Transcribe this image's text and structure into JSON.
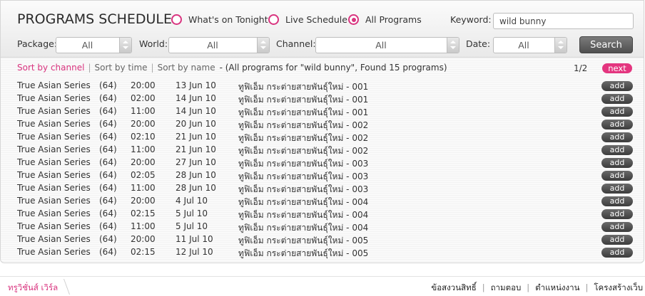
{
  "header": {
    "title": "PROGRAMS SCHEDULE",
    "radios": [
      {
        "label": "What's on Tonight",
        "selected": false
      },
      {
        "label": "Live Schedule",
        "selected": false
      },
      {
        "label": "All Programs",
        "selected": true
      }
    ],
    "keyword_label": "Keyword:",
    "keyword_value": "wild bunny",
    "filters": {
      "package_label": "Package:",
      "package_value": "All",
      "world_label": "World:",
      "world_value": "All",
      "channel_label": "Channel:",
      "channel_value": "All",
      "date_label": "Date:",
      "date_value": "All"
    },
    "search_label": "Search"
  },
  "sort": {
    "by_channel": "Sort by channel",
    "by_time": "Sort by time",
    "by_name": "Sort by name",
    "summary": "-  (All programs for \"wild bunny\", Found 15 programs)"
  },
  "pagination": {
    "page": "1/2",
    "next_label": "next"
  },
  "add_label": "add",
  "programs": [
    {
      "channel": "True Asian Series",
      "num": "(64)",
      "time": "20:00",
      "date": "13 Jun 10",
      "title": "ทูฟิเอ็ม กระต่ายสายพันธุ์ใหม่ - 001"
    },
    {
      "channel": "True Asian Series",
      "num": "(64)",
      "time": "02:00",
      "date": "14 Jun 10",
      "title": "ทูฟิเอ็ม กระต่ายสายพันธุ์ใหม่ - 001"
    },
    {
      "channel": "True Asian Series",
      "num": "(64)",
      "time": "11:00",
      "date": "14 Jun 10",
      "title": "ทูฟิเอ็ม กระต่ายสายพันธุ์ใหม่ - 001"
    },
    {
      "channel": "True Asian Series",
      "num": "(64)",
      "time": "20:00",
      "date": "20 Jun 10",
      "title": "ทูฟิเอ็ม กระต่ายสายพันธุ์ใหม่ - 002"
    },
    {
      "channel": "True Asian Series",
      "num": "(64)",
      "time": "02:10",
      "date": "21 Jun 10",
      "title": "ทูฟิเอ็ม กระต่ายสายพันธุ์ใหม่ - 002"
    },
    {
      "channel": "True Asian Series",
      "num": "(64)",
      "time": "11:00",
      "date": "21 Jun 10",
      "title": "ทูฟิเอ็ม กระต่ายสายพันธุ์ใหม่ - 002"
    },
    {
      "channel": "True Asian Series",
      "num": "(64)",
      "time": "20:00",
      "date": "27 Jun 10",
      "title": "ทูฟิเอ็ม กระต่ายสายพันธุ์ใหม่ - 003"
    },
    {
      "channel": "True Asian Series",
      "num": "(64)",
      "time": "02:05",
      "date": "28 Jun 10",
      "title": "ทูฟิเอ็ม กระต่ายสายพันธุ์ใหม่ - 003"
    },
    {
      "channel": "True Asian Series",
      "num": "(64)",
      "time": "11:00",
      "date": "28 Jun 10",
      "title": "ทูฟิเอ็ม กระต่ายสายพันธุ์ใหม่ - 003"
    },
    {
      "channel": "True Asian Series",
      "num": "(64)",
      "time": "20:00",
      "date": "4 Jul 10",
      "title": "ทูฟิเอ็ม กระต่ายสายพันธุ์ใหม่ - 004"
    },
    {
      "channel": "True Asian Series",
      "num": "(64)",
      "time": "02:15",
      "date": "5 Jul 10",
      "title": "ทูฟิเอ็ม กระต่ายสายพันธุ์ใหม่ - 004"
    },
    {
      "channel": "True Asian Series",
      "num": "(64)",
      "time": "11:00",
      "date": "5 Jul 10",
      "title": "ทูฟิเอ็ม กระต่ายสายพันธุ์ใหม่ - 004"
    },
    {
      "channel": "True Asian Series",
      "num": "(64)",
      "time": "20:00",
      "date": "11 Jul 10",
      "title": "ทูฟิเอ็ม กระต่ายสายพันธุ์ใหม่ - 005"
    },
    {
      "channel": "True Asian Series",
      "num": "(64)",
      "time": "02:15",
      "date": "12 Jul 10",
      "title": "ทูฟิเอ็ม กระต่ายสายพันธุ์ใหม่ - 005"
    }
  ],
  "footer": {
    "brand": "ทรูวิชั่นส์ เวิร์ล",
    "links": [
      "ข้อสงวนสิทธิ์",
      "ถามตอบ",
      "ตำแหน่งงาน",
      "โครงสร้างเว็บ"
    ]
  },
  "colors": {
    "accent": "#d9347f",
    "button_dark": "#4f4f4f"
  }
}
